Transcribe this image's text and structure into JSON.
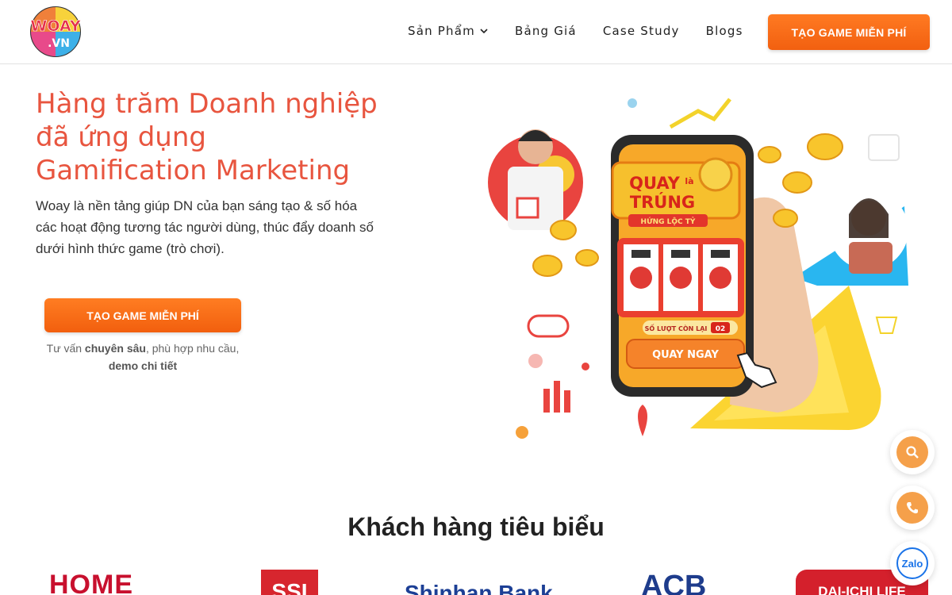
{
  "header": {
    "logo_text": "WOAY.VN",
    "nav": [
      {
        "label": "Sản Phẩm",
        "has_dropdown": true
      },
      {
        "label": "Bảng Giá"
      },
      {
        "label": "Case Study"
      },
      {
        "label": "Blogs"
      }
    ],
    "cta_label": "TẠO GAME MIỄN PHÍ"
  },
  "hero": {
    "title_lines": [
      "Hàng trăm Doanh nghiệp",
      "đã ứng dụng",
      "Gamification Marketing"
    ],
    "description": "Woay là nền tảng giúp DN của bạn sáng tạo & số hóa các hoạt động tương tác người dùng, thúc đẩy doanh số dưới hình thức game (trò chơi).",
    "cta_label": "TẠO GAME MIỄN PHÍ",
    "note_prefix": "Tư vấn ",
    "note_bold1": "chuyên sâu",
    "note_mid": ", phù hợp nhu cầu,",
    "note_bold2": "demo chi tiết"
  },
  "illustration": {
    "banner_line1": "QUAY",
    "banner_small": "là",
    "banner_line2": "TRÚNG",
    "banner_ribbon": "HỨNG LỘC TỶ",
    "spins_label": "SỐ LƯỢT CÒN LẠI",
    "spins_value": "02",
    "spin_button": "QUAY NGAY"
  },
  "clients": {
    "title": "Khách hàng tiêu biểu",
    "logos": [
      "HOME",
      "SSI",
      "Shinhan Bank",
      "ACB",
      "DAI-ICHI LIFE"
    ]
  },
  "floating": [
    "search-icon",
    "phone-icon",
    "zalo-icon"
  ],
  "floating_zalo_label": "Zalo",
  "colors": {
    "accent": "#e8553f",
    "cta": "#f26010",
    "fab": "#f5a04a"
  }
}
